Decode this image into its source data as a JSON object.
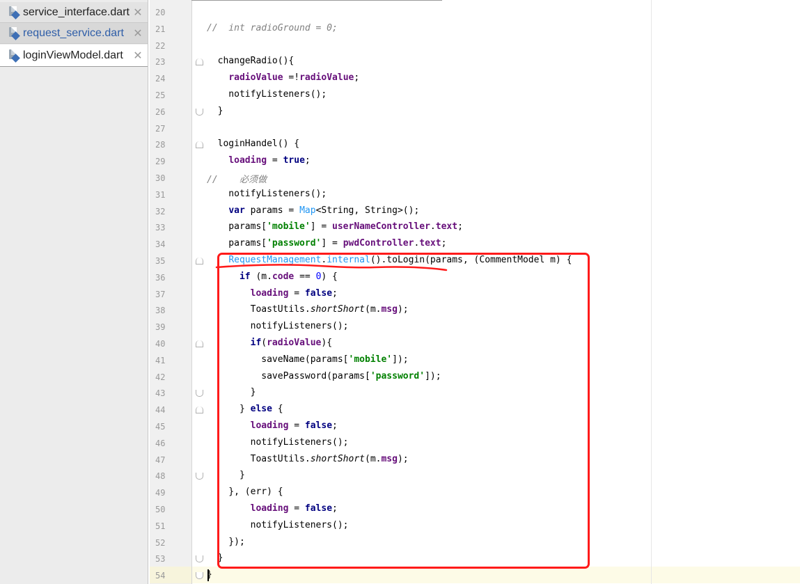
{
  "tabs": [
    {
      "name": "service_interface.dart",
      "close": "✕"
    },
    {
      "name": "request_service.dart",
      "close": "✕"
    },
    {
      "name": "loginViewModel.dart",
      "close": "✕"
    }
  ],
  "editor": {
    "lines": [
      {
        "n": "20",
        "text": ""
      },
      {
        "n": "21",
        "text": "//  int radioGround = 0;"
      },
      {
        "n": "22",
        "text": ""
      },
      {
        "n": "23",
        "text": "  changeRadio(){"
      },
      {
        "n": "24",
        "text": "    radioValue =!radioValue;"
      },
      {
        "n": "25",
        "text": "    notifyListeners();"
      },
      {
        "n": "26",
        "text": "  }"
      },
      {
        "n": "27",
        "text": ""
      },
      {
        "n": "28",
        "text": "  loginHandel() {"
      },
      {
        "n": "29",
        "text": "    loading = true;"
      },
      {
        "n": "30",
        "text": "//    必须做"
      },
      {
        "n": "31",
        "text": "    notifyListeners();"
      },
      {
        "n": "32",
        "text": "    var params = Map<String, String>();"
      },
      {
        "n": "33",
        "text": "    params['mobile'] = userNameController.text;"
      },
      {
        "n": "34",
        "text": "    params['password'] = pwdController.text;"
      },
      {
        "n": "35",
        "text": "    RequestManagement.internal().toLogin(params, (CommentModel m) {"
      },
      {
        "n": "36",
        "text": "      if (m.code == 0) {"
      },
      {
        "n": "37",
        "text": "        loading = false;"
      },
      {
        "n": "38",
        "text": "        ToastUtils.shortShort(m.msg);"
      },
      {
        "n": "39",
        "text": "        notifyListeners();"
      },
      {
        "n": "40",
        "text": "        if(radioValue){"
      },
      {
        "n": "41",
        "text": "          saveName(params['mobile']);"
      },
      {
        "n": "42",
        "text": "          savePassword(params['password']);"
      },
      {
        "n": "43",
        "text": "        }"
      },
      {
        "n": "44",
        "text": "      } else {"
      },
      {
        "n": "45",
        "text": "        loading = false;"
      },
      {
        "n": "46",
        "text": "        notifyListeners();"
      },
      {
        "n": "47",
        "text": "        ToastUtils.shortShort(m.msg);"
      },
      {
        "n": "48",
        "text": "      }"
      },
      {
        "n": "49",
        "text": "    }, (err) {"
      },
      {
        "n": "50",
        "text": "        loading = false;"
      },
      {
        "n": "51",
        "text": "        notifyListeners();"
      },
      {
        "n": "52",
        "text": "    });"
      },
      {
        "n": "53",
        "text": "  }"
      },
      {
        "n": "54",
        "text": "}"
      }
    ]
  },
  "colors": {
    "keyword": "#000080",
    "field": "#660e7a",
    "string": "#008000",
    "comment": "#808080",
    "class_ref": "#2196f3",
    "number": "#0000ff",
    "annotation": "#ff1a1a"
  }
}
